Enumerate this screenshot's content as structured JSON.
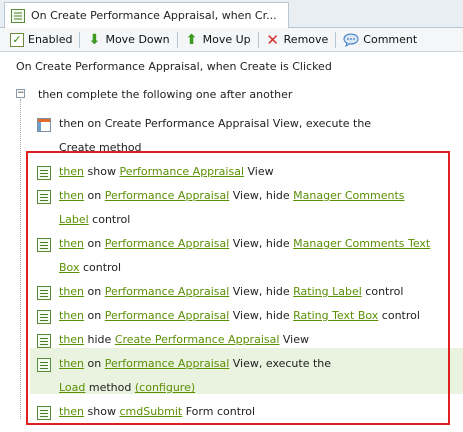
{
  "tab": {
    "label": "On Create Performance Appraisal, when Cr...",
    "icon": "rule-tab-icon"
  },
  "toolbar": {
    "enabled_label": "Enabled",
    "move_down_label": "Move Down",
    "move_up_label": "Move Up",
    "remove_label": "Remove",
    "comment_label": "Comment"
  },
  "rule_title": "On Create Performance Appraisal, when Create is Clicked",
  "group": {
    "label": "then complete the following one after another"
  },
  "steps": [
    {
      "icon": "view-icon",
      "line1": "then on Create Performance Appraisal View, execute the",
      "line2": "Create method"
    },
    {
      "then": "then",
      "pre": " show ",
      "link1": "Performance Appraisal",
      "post": " View"
    },
    {
      "then": "then",
      "pre": " on ",
      "link1": "Performance Appraisal",
      "mid": " View, hide ",
      "link2a": "Manager Comments",
      "link2b": "Label",
      "post": " control"
    },
    {
      "then": "then",
      "pre": " on ",
      "link1": "Performance Appraisal",
      "mid": " View, hide ",
      "link2a": "Manager Comments Text",
      "link2b": "Box",
      "post": " control"
    },
    {
      "then": "then",
      "pre": " on ",
      "link1": "Performance Appraisal",
      "mid": " View, hide ",
      "link2": "Rating Label",
      "post": " control"
    },
    {
      "then": "then",
      "pre": " on ",
      "link1": "Performance Appraisal",
      "mid": " View, hide ",
      "link2": "Rating Text Box",
      "post": " control"
    },
    {
      "then": "then",
      "pre": " hide ",
      "link1": "Create Performance Appraisal",
      "post": " View"
    },
    {
      "then": "then",
      "pre": " on ",
      "link1": "Performance Appraisal",
      "mid": " View, execute the",
      "link2": "Load",
      "post": " method ",
      "configure": "(configure)"
    },
    {
      "then": "then",
      "pre": " show ",
      "link1": "cmdSubmit",
      "post": " Form control"
    }
  ]
}
